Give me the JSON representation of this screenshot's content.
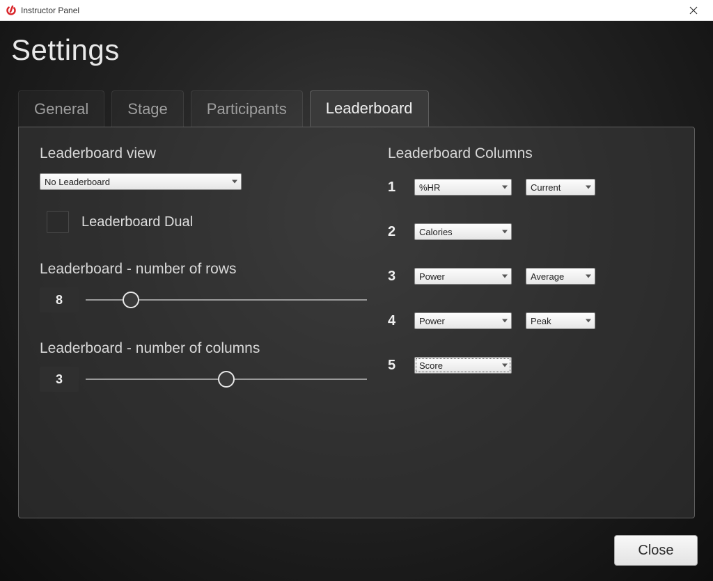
{
  "window": {
    "title": "Instructor Panel"
  },
  "page": {
    "title": "Settings"
  },
  "tabs": {
    "general": "General",
    "stage": "Stage",
    "participants": "Participants",
    "leaderboard": "Leaderboard"
  },
  "leaderboard": {
    "view_label": "Leaderboard view",
    "view_value": "No Leaderboard",
    "dual_label": "Leaderboard Dual",
    "rows_label": "Leaderboard - number of rows",
    "rows_value": "8",
    "cols_label": "Leaderboard - number of columns",
    "cols_value": "3",
    "columns_header": "Leaderboard Columns",
    "columns": [
      {
        "num": "1",
        "metric": "%HR",
        "agg": "Current"
      },
      {
        "num": "2",
        "metric": "Calories",
        "agg": ""
      },
      {
        "num": "3",
        "metric": "Power",
        "agg": "Average"
      },
      {
        "num": "4",
        "metric": "Power",
        "agg": "Peak"
      },
      {
        "num": "5",
        "metric": "Score",
        "agg": ""
      }
    ]
  },
  "buttons": {
    "close": "Close"
  }
}
